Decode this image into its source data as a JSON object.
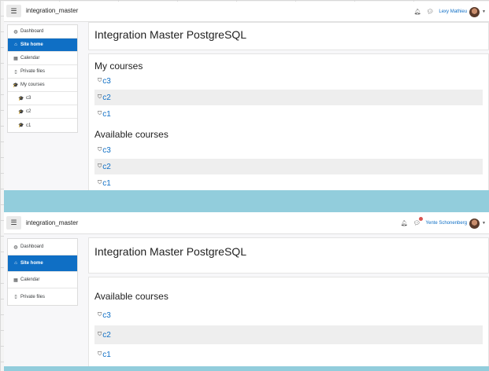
{
  "top": {
    "site_name": "integration_master",
    "user_name": "Lexy Mathieu",
    "page_title": "Integration Master PostgreSQL",
    "drawer": [
      {
        "label": "Dashboard",
        "icon": "dashboard-icon",
        "glyph": "◍"
      },
      {
        "label": "Site home",
        "icon": "home-icon",
        "glyph": "⌂"
      },
      {
        "label": "Calendar",
        "icon": "calendar-icon",
        "glyph": "▦"
      },
      {
        "label": "Private files",
        "icon": "file-icon",
        "glyph": "▯"
      },
      {
        "label": "My courses",
        "icon": "graduation-cap-icon",
        "glyph": "🎓"
      },
      {
        "label": "c3",
        "icon": "graduation-cap-icon",
        "glyph": "🎓"
      },
      {
        "label": "c2",
        "icon": "graduation-cap-icon",
        "glyph": "🎓"
      },
      {
        "label": "c1",
        "icon": "graduation-cap-icon",
        "glyph": "🎓"
      }
    ],
    "my_courses_title": "My courses",
    "my_courses": [
      "c3",
      "c2",
      "c1"
    ],
    "available_title": "Available courses",
    "available_courses": [
      "c3",
      "c2",
      "c1"
    ]
  },
  "bottom": {
    "site_name": "integration_master",
    "user_name": "Yente Schonenberg",
    "page_title": "Integration Master PostgreSQL",
    "drawer": [
      {
        "label": "Dashboard",
        "icon": "dashboard-icon",
        "glyph": "◍"
      },
      {
        "label": "Site home",
        "icon": "home-icon",
        "glyph": "⌂"
      },
      {
        "label": "Calendar",
        "icon": "calendar-icon",
        "glyph": "▦"
      },
      {
        "label": "Private files",
        "icon": "file-icon",
        "glyph": "▯"
      }
    ],
    "available_title": "Available courses",
    "available_courses": [
      "c3",
      "c2",
      "c1"
    ]
  },
  "colors": {
    "accent": "#0f6fc5",
    "divider": "#92cddc",
    "shaded_row": "#eeeeee"
  }
}
